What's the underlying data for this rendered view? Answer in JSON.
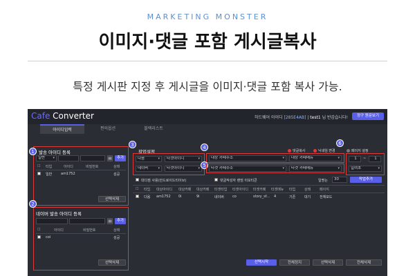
{
  "header": {
    "kicker": "MARKETING MONSTER",
    "title": "이미지·댓글 포함 게시글복사",
    "subtitle": "특정 게시판 지정 후 게시글을 이미지·댓글 포함 복사 가능."
  },
  "app": {
    "logo_cafe": "Cafe",
    "logo_converter": "Converter",
    "hw_label": "하드웨어 아이디",
    "hw_id": "[285E4AB]",
    "user": "test1",
    "greeting_suffix": "님 반갑습니다!",
    "top_button": "정구 원문보기",
    "tabs": [
      "아이디입력",
      "편의옵션",
      "블랙리스트"
    ],
    "badges": [
      "1",
      "2",
      "3",
      "4",
      "5",
      "6"
    ],
    "panel1": {
      "title": "발송 아이디 등록",
      "select": "일반",
      "add": "추가",
      "columns": [
        "타입",
        "아이디",
        "비밀번호",
        "상태"
      ],
      "row": {
        "type": "일반",
        "id": "am1752",
        "status": "성공"
      },
      "delete": "선택삭제"
    },
    "panel2": {
      "title": "네이버 발송 아이디 등록",
      "add": "추가",
      "columns": [
        "아이디",
        "비밀번호",
        "상태"
      ],
      "row": {
        "id": "coi",
        "status": "성공"
      },
      "delete": "선택삭제"
    },
    "work": {
      "title": "작업설정",
      "row1": [
        "다음",
        "타겟아이디"
      ],
      "row2": [
        "네이버",
        "타겟아이디"
      ],
      "target_cafe": "대상 카페주소",
      "target_menu": "대상 카페메뉴",
      "source_cafe": "타겟 카페주소",
      "source_menu": "타겟 카페메뉴",
      "opt_copy": "댓글복사",
      "opt_nick": "닉네임 변경",
      "opt_page": "페이지 설정",
      "page_from": "1",
      "page_to": "1",
      "page_sep": "~",
      "order": "일여초",
      "check1": "대다점 사용(안드로이드티이브)",
      "check2": "댓글작성자 랜덤 이모티콘",
      "interval_label": "일명는",
      "interval": "30",
      "add_job": "작업추가",
      "columns": [
        "타입",
        "대상아이디",
        "대상카페",
        "대상카페",
        "타겟타입",
        "타겟아이디",
        "타겟카페",
        "타겟메뉴",
        "타입",
        "상태",
        "페이지"
      ],
      "row": [
        "다음",
        "am1752",
        "0i",
        "9i",
        "네이버",
        "co",
        "story_sf...",
        "4",
        "기존",
        "대기",
        "전체모드"
      ],
      "start": "선택시작",
      "stop_all": "전체정지",
      "delete_sel": "선택삭제",
      "delete_all": "전체삭제"
    }
  },
  "colors": {
    "accent": "#5a5fe8",
    "highlight": "#e0393a",
    "bg": "#2a2d33"
  }
}
